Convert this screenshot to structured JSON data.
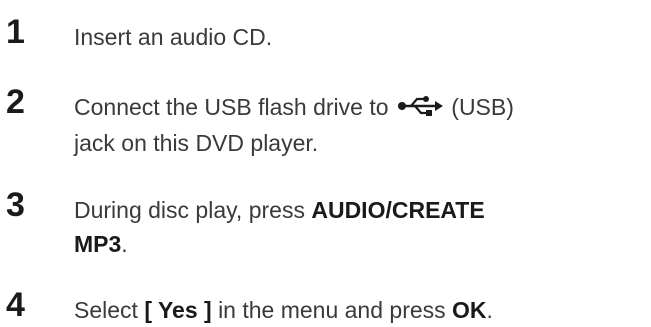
{
  "steps": [
    {
      "number": "1",
      "text": "Insert an audio CD."
    },
    {
      "number": "2",
      "text_before_icon": "Connect the USB flash drive to",
      "icon": "usb-icon",
      "text_after_icon": "(USB)",
      "text_line2": "jack on this DVD player."
    },
    {
      "number": "3",
      "text_before_bold": "During disc play, press",
      "bold_line1": "AUDIO/CREATE",
      "bold_line2": "MP3",
      "text_after_bold": "."
    },
    {
      "number": "4",
      "text_before_bold": "Select",
      "bold_option": "[ Yes ]",
      "text_middle": "in the menu and press",
      "bold_key": "OK",
      "text_after_bold": "."
    }
  ]
}
